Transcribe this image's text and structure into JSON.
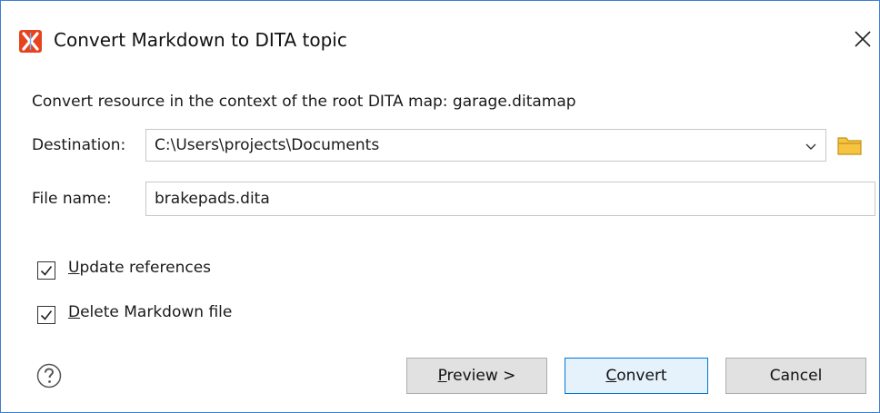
{
  "window": {
    "title": "Convert Markdown to DITA topic",
    "app_icon": "oxygen-x-logo-icon",
    "close_icon": "close-icon",
    "accent_color": "#3b7fd1"
  },
  "context": {
    "text": "Convert resource in the context of the root DITA map: garage.ditamap"
  },
  "destination": {
    "label": "Destination:",
    "value": "C:\\Users\\projects\\Documents",
    "dropdown_icon": "chevron-down-icon",
    "browse_icon": "folder-icon"
  },
  "file_name": {
    "label": "File name:",
    "value": "brakepads.dita"
  },
  "options": {
    "update_references": {
      "accel": "U",
      "rest": "pdate references",
      "checked": true
    },
    "delete_markdown": {
      "accel": "D",
      "rest": "elete Markdown file",
      "checked": true
    }
  },
  "buttons": {
    "help_icon": "help-icon",
    "preview_accel": "P",
    "preview_rest": "review >",
    "convert_accel": "C",
    "convert_rest": "onvert",
    "cancel": "Cancel"
  }
}
